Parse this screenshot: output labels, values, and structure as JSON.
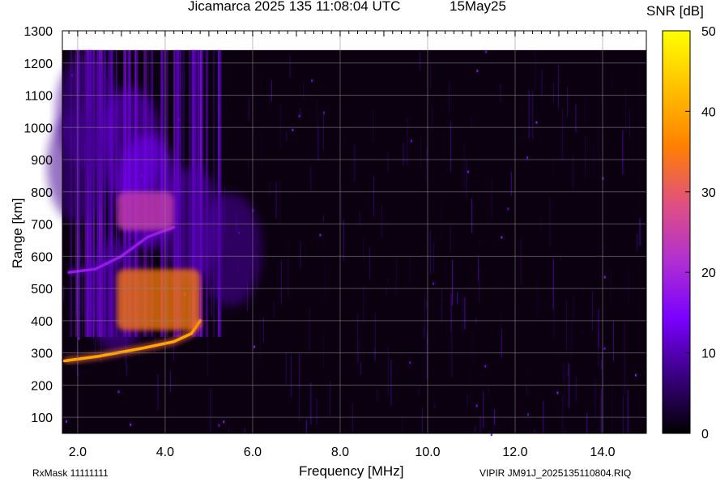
{
  "chart_data": {
    "type": "heatmap",
    "title": "Jicamarca 2025 135 11:08:04 UTC",
    "subtitle": "15May25",
    "xlabel": "Frequency [MHz]",
    "ylabel": "Range [km]",
    "xlim": [
      1.65,
      15.0
    ],
    "ylim": [
      50,
      1300
    ],
    "x_ticks": [
      "2.0",
      "4.0",
      "6.0",
      "8.0",
      "10.0",
      "12.0",
      "14.0"
    ],
    "x_tick_values": [
      2,
      4,
      6,
      8,
      10,
      12,
      14
    ],
    "y_ticks": [
      "100",
      "200",
      "300",
      "400",
      "500",
      "600",
      "700",
      "800",
      "900",
      "1000",
      "1100",
      "1200",
      "1300"
    ],
    "y_tick_values": [
      100,
      200,
      300,
      400,
      500,
      600,
      700,
      800,
      900,
      1000,
      1100,
      1200,
      1300
    ],
    "data_top_range": 1240,
    "colorbar": {
      "label": "SNR [dB]",
      "range": [
        0,
        50
      ],
      "ticks": [
        "0",
        "10",
        "20",
        "30",
        "40",
        "50"
      ],
      "tick_values": [
        0,
        10,
        20,
        30,
        40,
        50
      ],
      "colors": [
        "#000000",
        "#3a0080",
        "#7a00ff",
        "#b030d0",
        "#e05080",
        "#ff8000",
        "#ffc000",
        "#ffff00"
      ]
    },
    "features": [
      {
        "name": "F-layer trace",
        "snr_db": 40,
        "points": [
          [
            1.7,
            275
          ],
          [
            2.5,
            290
          ],
          [
            3.5,
            315
          ],
          [
            4.2,
            335
          ],
          [
            4.6,
            360
          ],
          [
            4.8,
            400
          ]
        ]
      },
      {
        "name": "F-layer echo block",
        "snr_db": 35,
        "f_range": [
          2.9,
          4.8
        ],
        "range": [
          370,
          560
        ]
      },
      {
        "name": "second-hop trace",
        "snr_db": 18,
        "points": [
          [
            1.8,
            550
          ],
          [
            2.4,
            560
          ],
          [
            3.0,
            600
          ],
          [
            3.6,
            660
          ],
          [
            4.2,
            690
          ]
        ]
      },
      {
        "name": "second-hop echo",
        "snr_db": 25,
        "f_range": [
          2.9,
          4.2
        ],
        "range": [
          680,
          800
        ]
      }
    ],
    "grid": true
  },
  "labels": {
    "title": "Jicamarca 2025 135 11:08:04 UTC",
    "subtitle": "15May25",
    "colorbar_label": "SNR [dB]",
    "xlabel": "Frequency [MHz]",
    "ylabel": "Range [km]",
    "rxmask": "RxMask 11111111",
    "fileinfo": "VIPIR  JM91J_2025135110804.RIQ"
  }
}
